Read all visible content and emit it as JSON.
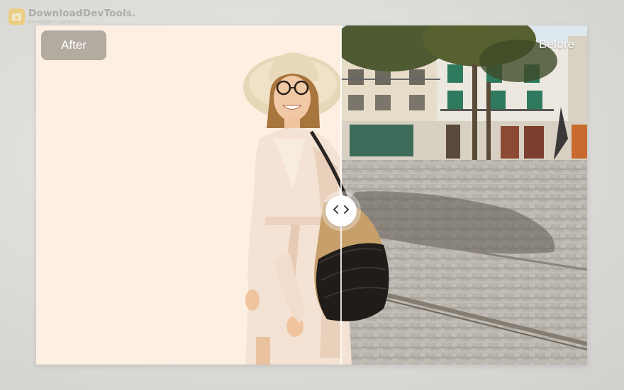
{
  "watermark": {
    "title": "DownloadDevTools.",
    "subtitle": "developer's paradise",
    "logo_icon": "folder-logo-icon"
  },
  "comparison": {
    "after_label": "After",
    "before_label": "Before",
    "after_background_color": "#fdf0e2",
    "divider_position_fraction": 0.553,
    "handle_icon": "chevron-left-right-icon"
  }
}
